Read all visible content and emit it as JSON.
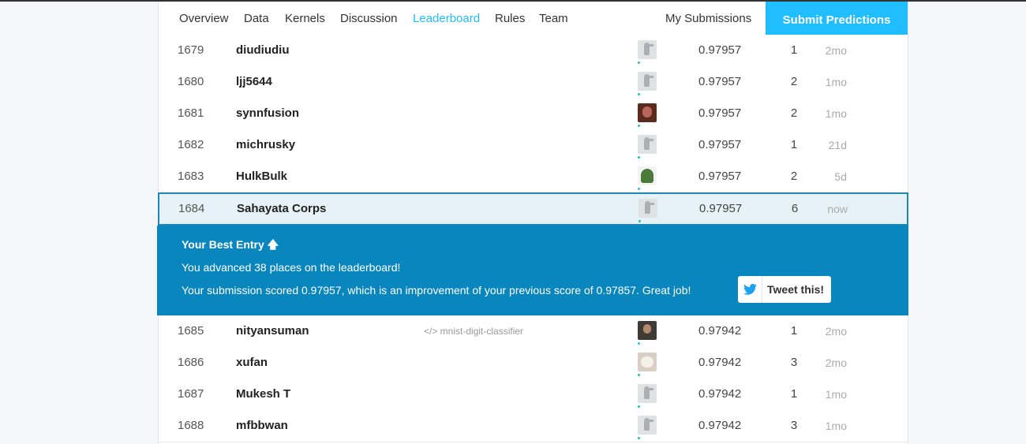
{
  "nav": {
    "tabs": [
      {
        "label": "Overview",
        "active": false
      },
      {
        "label": "Data",
        "active": false
      },
      {
        "label": "Kernels",
        "active": false
      },
      {
        "label": "Discussion",
        "active": false
      },
      {
        "label": "Leaderboard",
        "active": true
      },
      {
        "label": "Rules",
        "active": false
      },
      {
        "label": "Team",
        "active": false
      }
    ],
    "my_submissions": "My Submissions",
    "submit_button": "Submit Predictions"
  },
  "rows_before": [
    {
      "rank": "1679",
      "team": "diudiudiu",
      "kernel": "",
      "avatar": "default-bird",
      "score": "0.97957",
      "entries": "1",
      "last": "2mo"
    },
    {
      "rank": "1680",
      "team": "ljj5644",
      "kernel": "",
      "avatar": "default-bird",
      "score": "0.97957",
      "entries": "2",
      "last": "1mo"
    },
    {
      "rank": "1681",
      "team": "synnfusion",
      "kernel": "",
      "avatar": "photo",
      "score": "0.97957",
      "entries": "2",
      "last": "1mo"
    },
    {
      "rank": "1682",
      "team": "michrusky",
      "kernel": "",
      "avatar": "default-bird",
      "score": "0.97957",
      "entries": "1",
      "last": "21d"
    },
    {
      "rank": "1683",
      "team": "HulkBulk",
      "kernel": "",
      "avatar": "photo",
      "score": "0.97957",
      "entries": "2",
      "last": "5d"
    }
  ],
  "highlight_row": {
    "rank": "1684",
    "team": "Sahayata Corps",
    "score": "0.97957",
    "entries": "6",
    "last": "now"
  },
  "best_entry": {
    "title": "Your Best Entry",
    "arrow_icon": "arrow-up-icon",
    "line1": "You advanced 38 places on the leaderboard!",
    "line2": "Your submission scored 0.97957, which is an improvement of your previous score of 0.97857. Great job!",
    "tweet_label": "Tweet this!",
    "tweet_icon": "twitter-icon"
  },
  "rows_after": [
    {
      "rank": "1685",
      "team": "nityansuman",
      "kernel": "</> mnist-digit-classifier",
      "avatar": "photo",
      "score": "0.97942",
      "entries": "1",
      "last": "2mo"
    },
    {
      "rank": "1686",
      "team": "xufan",
      "kernel": "",
      "avatar": "photo",
      "score": "0.97942",
      "entries": "3",
      "last": "2mo"
    },
    {
      "rank": "1687",
      "team": "Mukesh T",
      "kernel": "",
      "avatar": "default-bird",
      "score": "0.97942",
      "entries": "1",
      "last": "1mo"
    },
    {
      "rank": "1688",
      "team": "mfbbwan",
      "kernel": "",
      "avatar": "default-bird",
      "score": "0.97942",
      "entries": "3",
      "last": "1mo"
    }
  ],
  "colors": {
    "accent": "#20beff",
    "banner": "#0a86bf",
    "highlight_bg": "#e6f2f8"
  }
}
